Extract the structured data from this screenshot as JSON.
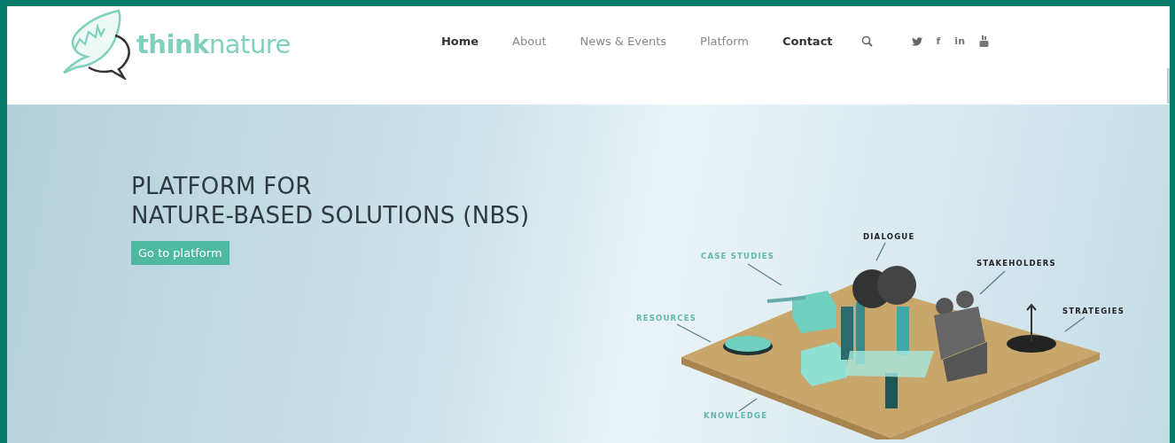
{
  "header": {
    "logo_text": "**think**nature",
    "nav": [
      {
        "label": "Home",
        "highlighted": true
      },
      {
        "label": "About",
        "highlighted": false
      },
      {
        "label": "News & Events",
        "highlighted": false
      },
      {
        "label": "Platform",
        "highlighted": false
      },
      {
        "label": "Contact",
        "highlighted": true
      }
    ],
    "social": [
      {
        "kind": "twitter"
      },
      {
        "kind": "facebook",
        "glyph": "f"
      },
      {
        "kind": "linkedin",
        "glyph": "in"
      },
      {
        "kind": "youtube"
      }
    ]
  },
  "hero": {
    "title_lines": [
      "PLATFORM FOR",
      "NATURE-BASED SOLUTIONS (NBS)"
    ],
    "button": "Go to platform",
    "illustration_labels": [
      {
        "text": "CASE STUDIES",
        "color": "#5fb8a8"
      },
      {
        "text": "DIALOGUE",
        "color": "#222222"
      },
      {
        "text": "STAKEHOLDERS",
        "color": "#222222"
      },
      {
        "text": "RESOURCES",
        "color": "#5fb8a8"
      },
      {
        "text": "STRATEGIES",
        "color": "#222222"
      },
      {
        "text": "KNOWLEDGE",
        "color": "#5fb8a8"
      }
    ]
  }
}
